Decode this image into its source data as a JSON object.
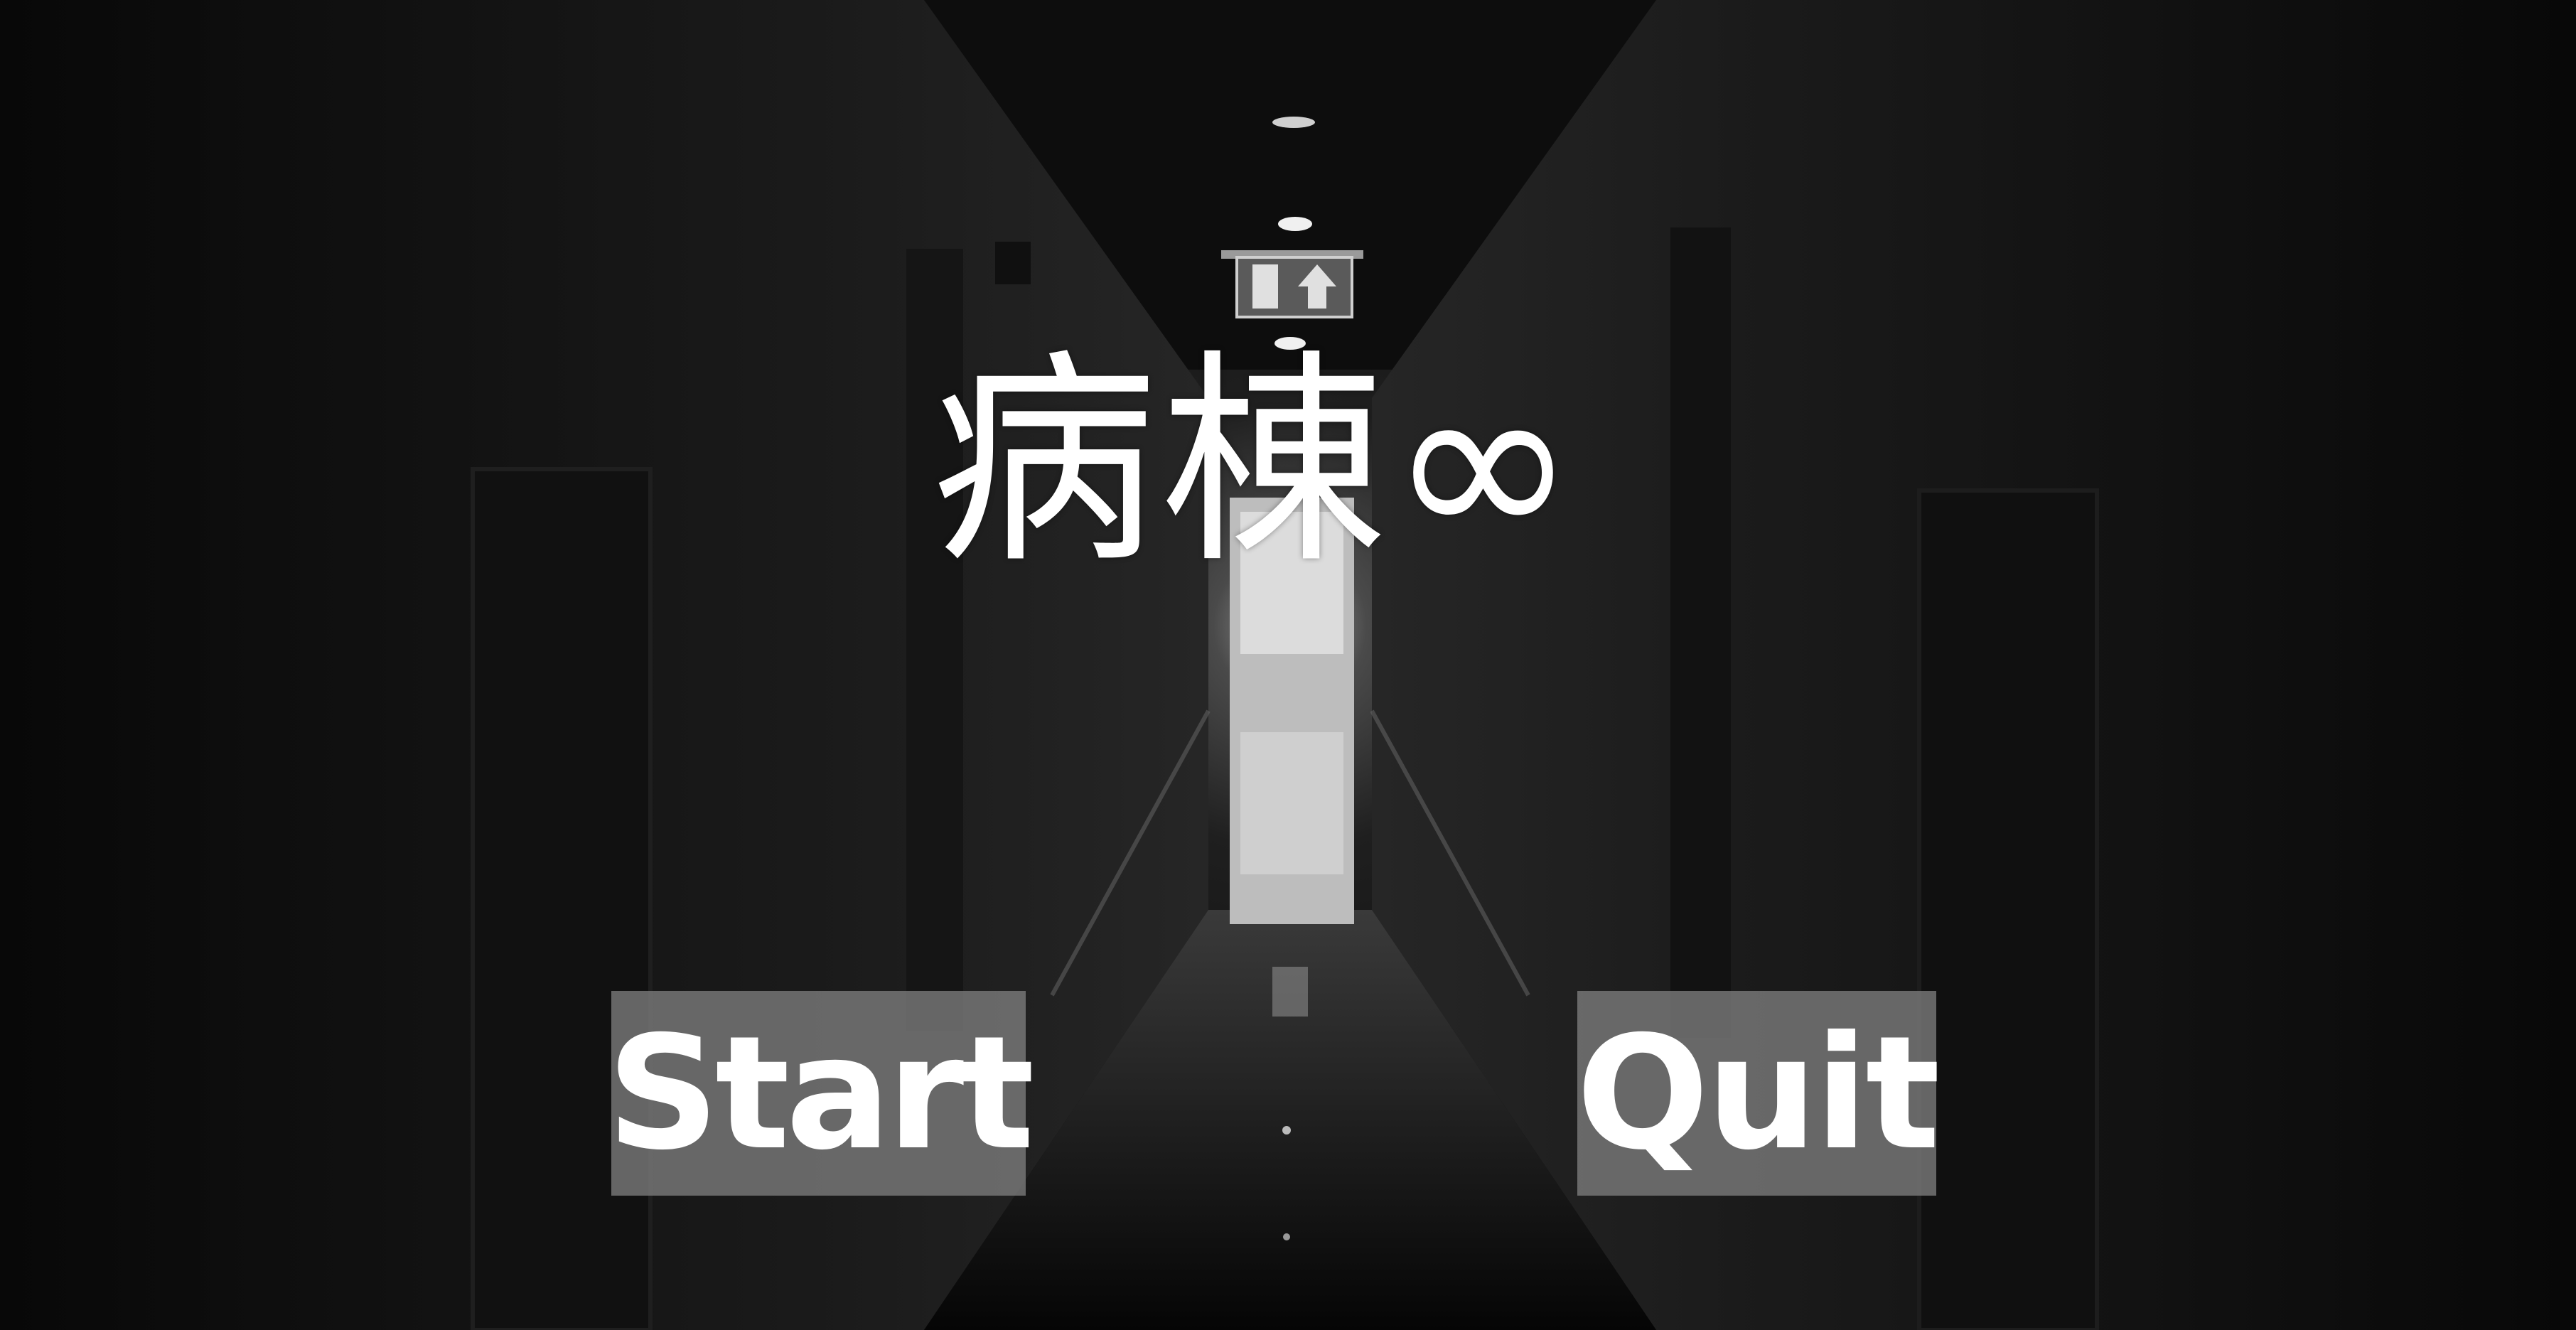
{
  "game": {
    "title": "病棟∞",
    "start_label": "Start",
    "quit_label": "Quit"
  },
  "scene": {
    "background_description_colors": {
      "wall": "#1a1a1a",
      "floor": "#0c0c0c",
      "light": "#e8e8e8",
      "button_bg": "#7d7d7d",
      "text": "#ffffff"
    }
  }
}
